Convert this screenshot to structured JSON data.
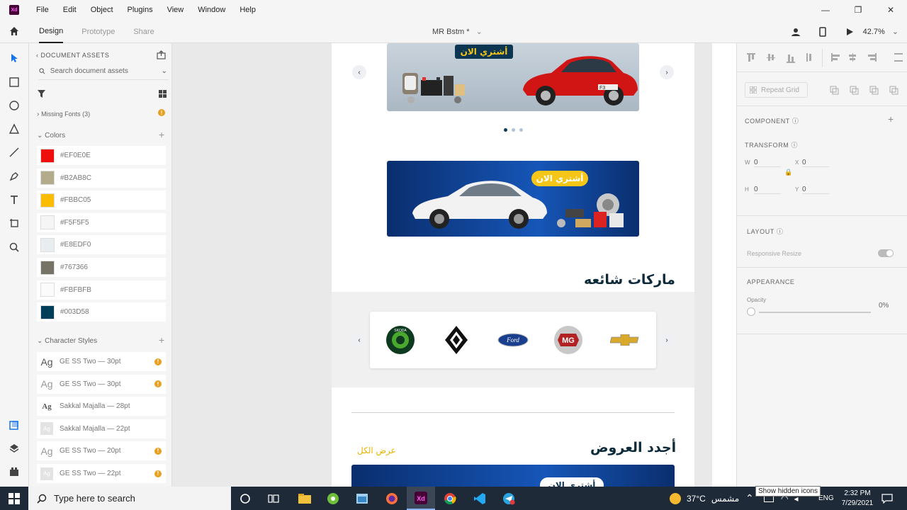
{
  "window": {
    "logo_text": "Xd",
    "menu": [
      "File",
      "Edit",
      "Object",
      "Plugins",
      "View",
      "Window",
      "Help"
    ],
    "controls": [
      "—",
      "❐",
      "✕"
    ]
  },
  "toolbar": {
    "tabs": [
      "Design",
      "Prototype",
      "Share"
    ],
    "doc_title": "MR Bstm *",
    "zoom": "42.7%"
  },
  "assets": {
    "header": "DOCUMENT ASSETS",
    "search_placeholder": "Search document assets",
    "missing_fonts": "Missing Fonts (3)",
    "colors_label": "Colors",
    "colors": [
      {
        "hex": "#EF0E0E",
        "label": "#EF0E0E"
      },
      {
        "hex": "#B2AB8C",
        "label": "#B2AB8C"
      },
      {
        "hex": "#FBBC05",
        "label": "#FBBC05"
      },
      {
        "hex": "#F5F5F5",
        "label": "#F5F5F5"
      },
      {
        "hex": "#E8EDF0",
        "label": "#E8EDF0"
      },
      {
        "hex": "#767366",
        "label": "#767366"
      },
      {
        "hex": "#FBFBFB",
        "label": "#FBFBFB"
      },
      {
        "hex": "#003D58",
        "label": "#003D58"
      }
    ],
    "char_styles_label": "Character Styles",
    "char_styles": [
      {
        "ag": "Ag",
        "name": "GE SS Two — 30pt",
        "warn": true
      },
      {
        "ag": "Ag",
        "name": "GE SS Two — 30pt",
        "warn": true
      },
      {
        "ag": "Ag",
        "name": "Sakkal Majalla — 28pt",
        "warn": false
      },
      {
        "ag": "Ag",
        "name": "Sakkal Majalla — 22pt",
        "warn": false
      },
      {
        "ag": "Ag",
        "name": "GE SS Two — 20pt",
        "warn": true
      },
      {
        "ag": "Ag",
        "name": "GE SS Two — 22pt",
        "warn": true
      }
    ]
  },
  "canvas": {
    "banner1_label": "أشتري الان",
    "banner2_label": "أشتري الان",
    "car_plate": "F3",
    "brands_heading": "ماركات شائعه",
    "brands": [
      "skoda",
      "renault",
      "ford",
      "mg",
      "chevrolet"
    ],
    "brand_texts": {
      "skoda": "SKODA",
      "ford": "Ford",
      "mg": "MG"
    },
    "offers_heading": "أجدد العروض",
    "see_all": "عرض الكل",
    "banner3_label": "أشتري الان"
  },
  "props": {
    "repeat_grid": "Repeat Grid",
    "component": "COMPONENT",
    "transform": "TRANSFORM",
    "w_label": "W",
    "w_value": "0",
    "h_label": "H",
    "h_value": "0",
    "x_label": "X",
    "x_value": "0",
    "y_label": "Y",
    "y_value": "0",
    "layout": "LAYOUT",
    "responsive_resize": "Responsive Resize",
    "appearance": "APPEARANCE",
    "opacity_label": "Opacity",
    "opacity_value": "0%"
  },
  "taskbar": {
    "search_placeholder": "Type here to search",
    "weather_temp": "37°C",
    "weather_text": "مشمس",
    "language": "ENG",
    "time": "2:32 PM",
    "date": "7/29/2021",
    "tooltip": "Show hidden icons"
  },
  "accents": {
    "xd_purple": "#470137",
    "xd_pink": "#ff61f6",
    "navy": "#003D58",
    "gold": "#FBBC05"
  }
}
